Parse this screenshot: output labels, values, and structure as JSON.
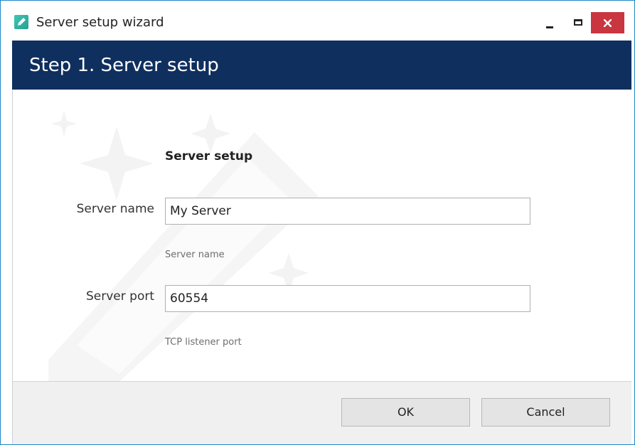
{
  "window": {
    "title": "Server setup wizard",
    "app_icon": "pencil-app-icon",
    "controls": [
      "minimize-icon",
      "maximize-icon",
      "close-icon"
    ],
    "colors": {
      "header_bg": "#0f2f5e",
      "close_bg": "#c9363f",
      "footer_bg": "#f0f0f0",
      "window_border": "#1e88c8"
    }
  },
  "header": {
    "title": "Step 1. Server setup"
  },
  "form": {
    "section_title": "Server setup",
    "server_name": {
      "label": "Server name",
      "value": "My Server",
      "hint": "Server name"
    },
    "server_port": {
      "label": "Server port",
      "value": "60554",
      "hint": "TCP listener port"
    }
  },
  "footer": {
    "ok_label": "OK",
    "cancel_label": "Cancel"
  }
}
